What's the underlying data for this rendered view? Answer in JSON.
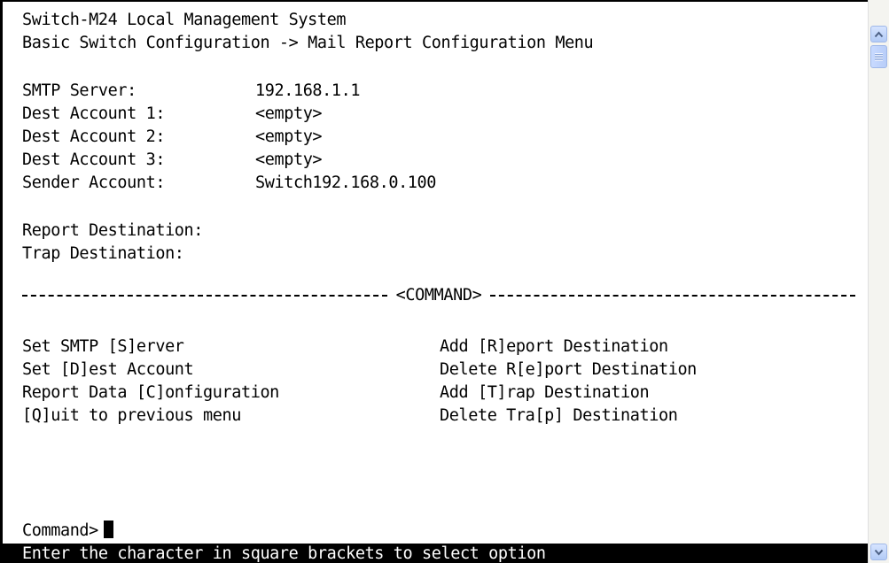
{
  "header": {
    "title": "Switch-M24 Local Management System",
    "breadcrumb": "Basic Switch Configuration -> Mail Report Configuration Menu"
  },
  "fields": [
    {
      "label": "SMTP Server:",
      "value": "192.168.1.1"
    },
    {
      "label": "Dest Account 1:",
      "value": "<empty>"
    },
    {
      "label": "Dest Account 2:",
      "value": "<empty>"
    },
    {
      "label": "Dest Account 3:",
      "value": "<empty>"
    },
    {
      "label": "Sender Account:",
      "value": "Switch192.168.0.100"
    }
  ],
  "destinations": {
    "report_label": "Report Destination:",
    "trap_label": "Trap Destination:"
  },
  "divider_label": "<COMMAND>",
  "commands_left": [
    "Set SMTP [S]erver",
    "Set [D]est Account",
    "Report Data [C]onfiguration",
    "[Q]uit to previous menu"
  ],
  "commands_right": [
    "Add [R]eport Destination",
    "Delete R[e]port Destination",
    "Add [T]rap Destination",
    "Delete Tra[p] Destination"
  ],
  "prompt": "Command>",
  "status_bar": "Enter the character in square brackets to select option",
  "icons": {
    "scroll_up": "scroll-up-arrow-icon",
    "scroll_down": "scroll-down-arrow-icon"
  },
  "colors": {
    "background": "#ffffff",
    "text": "#000000",
    "status_bar_bg": "#000000",
    "status_bar_text": "#ffffff"
  }
}
